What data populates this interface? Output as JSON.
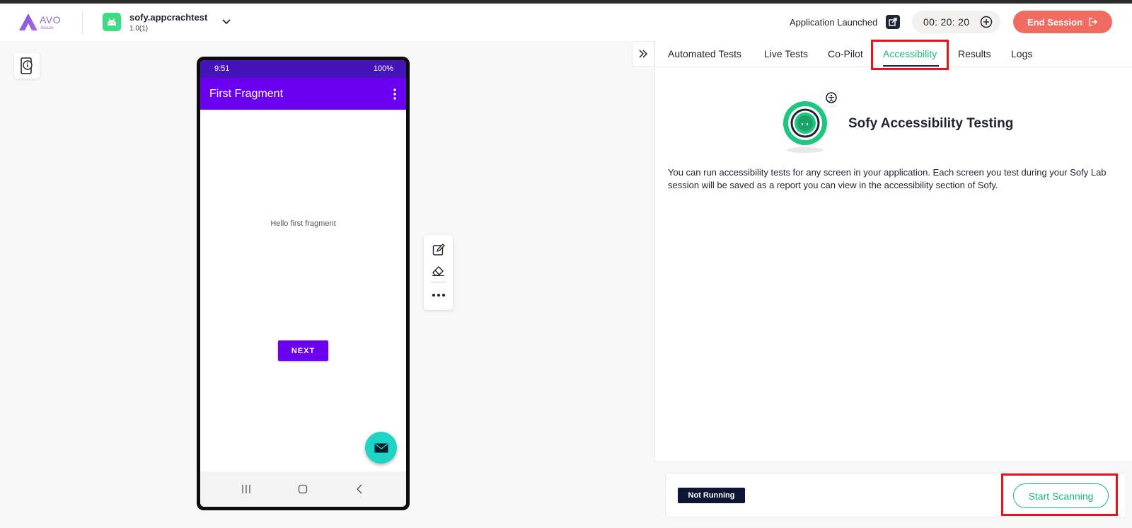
{
  "brand": {
    "logo_text": "AVO",
    "logo_subtext": "Assure"
  },
  "app": {
    "name": "sofy.appcrachtest",
    "version": "1.0(1)"
  },
  "header": {
    "status_text": "Application Launched",
    "timer": "00: 20: 20",
    "end_session_label": "End Session",
    "accent_color": "#f06b60"
  },
  "device": {
    "status_time": "9:51",
    "battery": "100%",
    "app_bar_title": "First Fragment",
    "content_text": "Hello first fragment",
    "next_button_label": "NEXT",
    "app_bar_color": "#6b00f0",
    "fab_color": "#1ed4c4"
  },
  "tabs": [
    {
      "label": "Automated Tests",
      "active": false
    },
    {
      "label": "Live Tests",
      "active": false
    },
    {
      "label": "Co-Pilot",
      "active": false
    },
    {
      "label": "Accessibility",
      "active": true
    },
    {
      "label": "Results",
      "active": false
    },
    {
      "label": "Logs",
      "active": false
    }
  ],
  "accessibility": {
    "title": "Sofy Accessibility Testing",
    "description": "You can run accessibility tests for any screen in your application. Each screen you test during your Sofy Lab session will be saved as a report you can view in the accessibility section of Sofy.",
    "status_badge": "Not Running",
    "start_button_label": "Start Scanning",
    "accent_color": "#1db97d"
  }
}
